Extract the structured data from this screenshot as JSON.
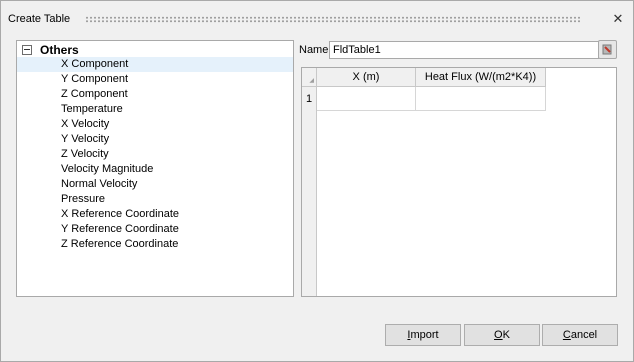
{
  "dialog": {
    "title": "Create Table",
    "close_glyph": "✕"
  },
  "tree": {
    "root_label": "Others",
    "items": [
      "X Component",
      "Y Component",
      "Z Component",
      "Temperature",
      "X Velocity",
      "Y Velocity",
      "Z Velocity",
      "Velocity Magnitude",
      "Normal Velocity",
      "Pressure",
      "X Reference Coordinate",
      "Y Reference Coordinate",
      "Z Reference Coordinate"
    ],
    "selected_index": 0
  },
  "name_field": {
    "label": "Name",
    "value": "FldTable1",
    "button_icon": "table-edit-icon"
  },
  "table": {
    "columns": [
      "X (m)",
      "Heat Flux (W/(m2*K4))"
    ],
    "rows": [
      {
        "index": "1",
        "cells": [
          "",
          ""
        ]
      }
    ]
  },
  "buttons": {
    "import": {
      "mnemonic": "I",
      "rest": "mport"
    },
    "ok": {
      "mnemonic": "O",
      "rest": "K"
    },
    "cancel": {
      "mnemonic": "C",
      "rest": "ancel"
    }
  },
  "colors": {
    "selection": "#e5f1fb",
    "dialog_bg": "#f0f0f0",
    "border": "#a9a9a9"
  }
}
